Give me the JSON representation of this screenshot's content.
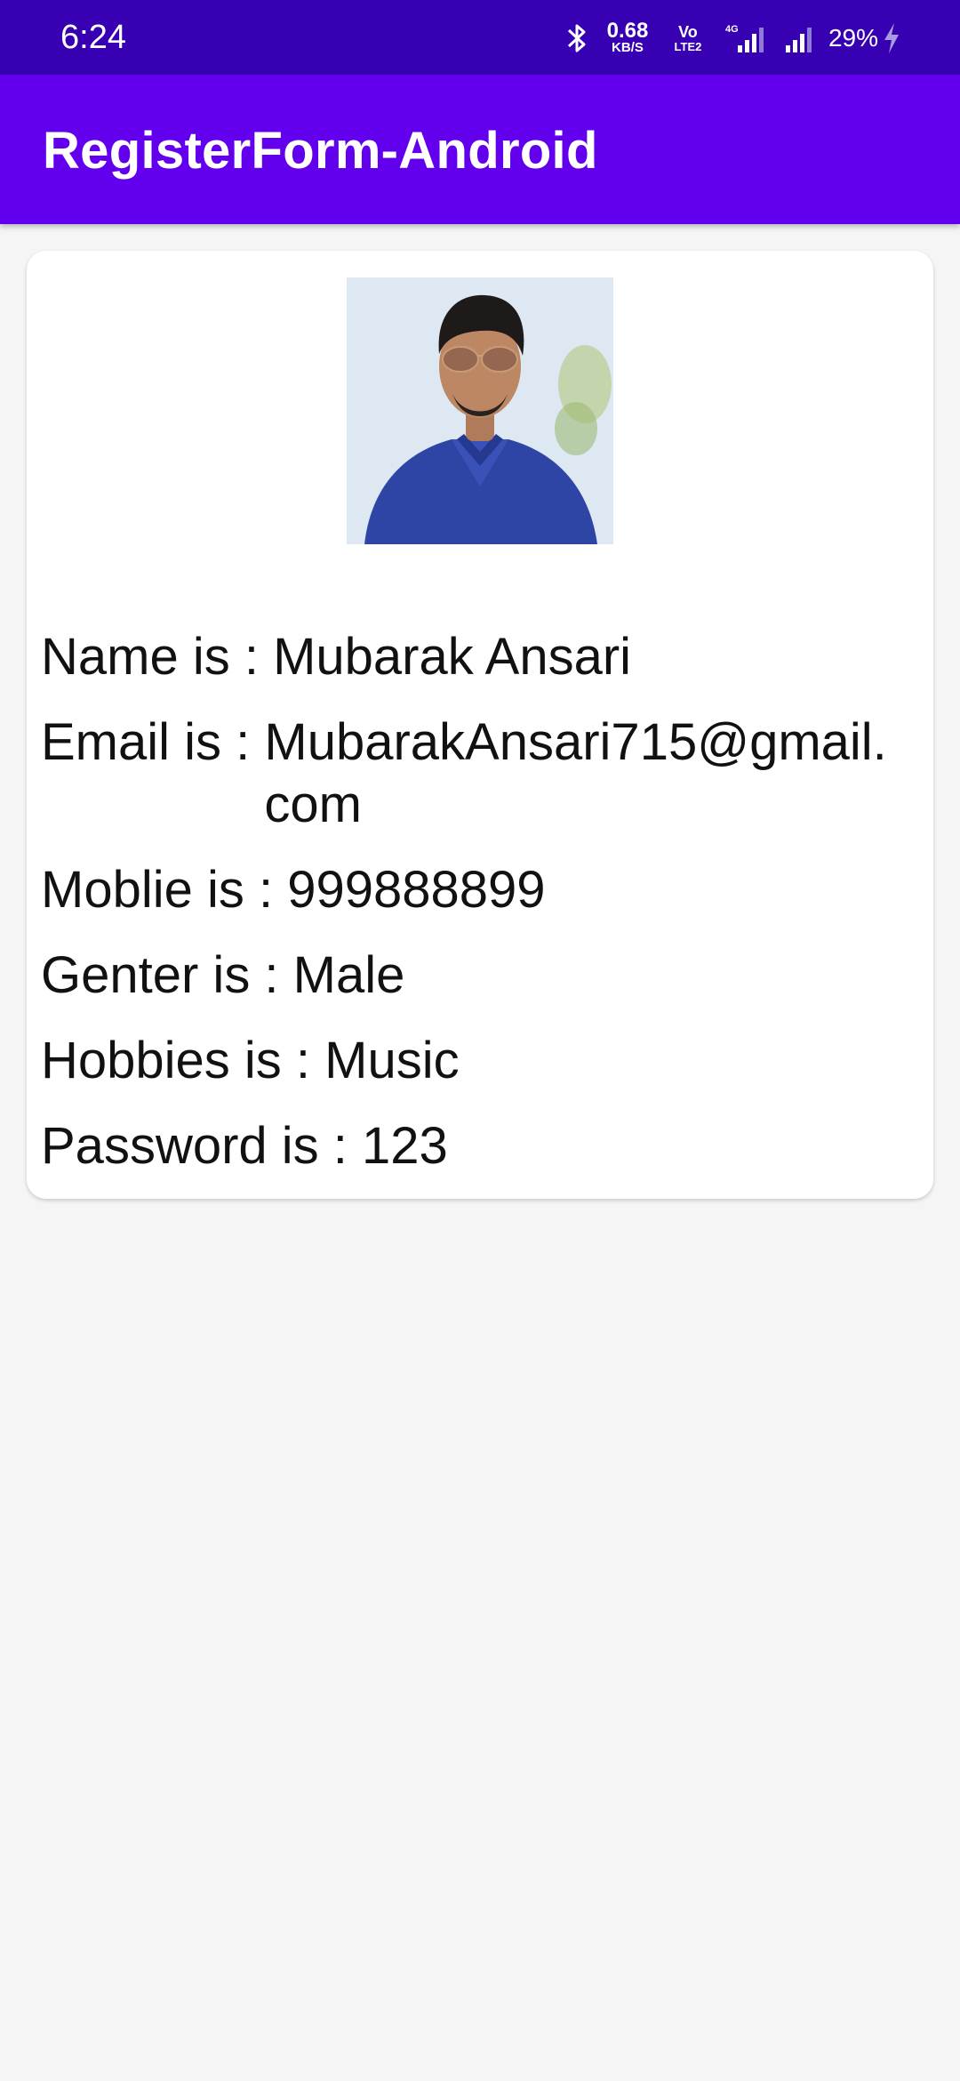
{
  "status_bar": {
    "time": "6:24",
    "net_speed_value": "0.68",
    "net_speed_unit": "KB/S",
    "volte_top": "Vo",
    "volte_bottom": "LTE2",
    "network_type": "4G",
    "battery": "29%",
    "icons": [
      "bluetooth-icon",
      "signal-4g-icon",
      "signal-icon",
      "charging-bolt-icon"
    ]
  },
  "app_bar": {
    "title": "RegisterForm-Android",
    "color": "#6200ee",
    "status_color": "#3700b3"
  },
  "profile": {
    "photo": "profile-photo",
    "fields": [
      {
        "label": "Name is : ",
        "value": "Mubarak Ansari"
      },
      {
        "label": "Email is : ",
        "value": "MubarakAnsari715@gmail.com"
      },
      {
        "label": "Moblie is : ",
        "value": "999888899"
      },
      {
        "label": "Genter is : ",
        "value": "Male"
      },
      {
        "label": "Hobbies is : ",
        "value": "Music"
      },
      {
        "label": "Password is : ",
        "value": "123"
      }
    ]
  }
}
